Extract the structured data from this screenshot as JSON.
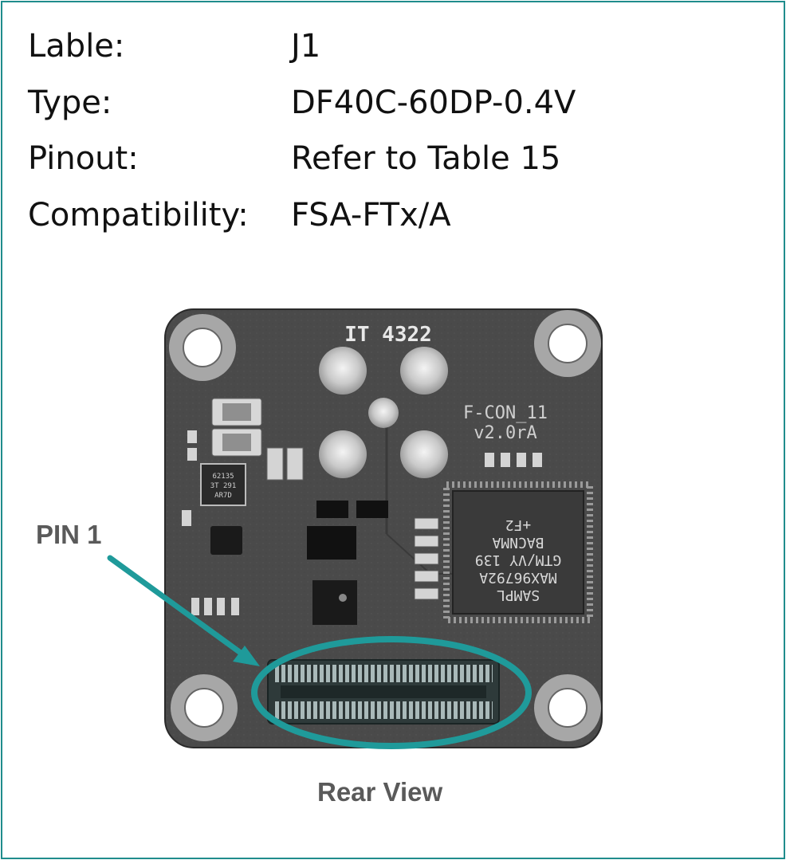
{
  "info": [
    {
      "label": "Lable:",
      "value": "J1"
    },
    {
      "label": "Type:",
      "value": "DF40C-60DP-0.4V"
    },
    {
      "label": "Pinout:",
      "value": "Refer to Table 15"
    },
    {
      "label": "Compatibility:",
      "value": "FSA-FTx/A"
    }
  ],
  "board": {
    "silkscreen_top": "IT 4322",
    "silkscreen_rev_1": "F-CON_11",
    "silkscreen_rev_2": "v2.0rA",
    "chip_lines": [
      "SAMPL",
      "MAX96792A",
      "GTM/VY 139",
      "BACNMA",
      "+F2"
    ],
    "small_chip_lines": [
      "62135",
      "3T 291",
      "AR7D"
    ]
  },
  "callouts": {
    "pin1": "PIN 1",
    "view": "Rear View"
  },
  "colors": {
    "accent": "#1f8c8c",
    "pcb": "#4a4a4a",
    "caption": "#5a5a5a"
  }
}
